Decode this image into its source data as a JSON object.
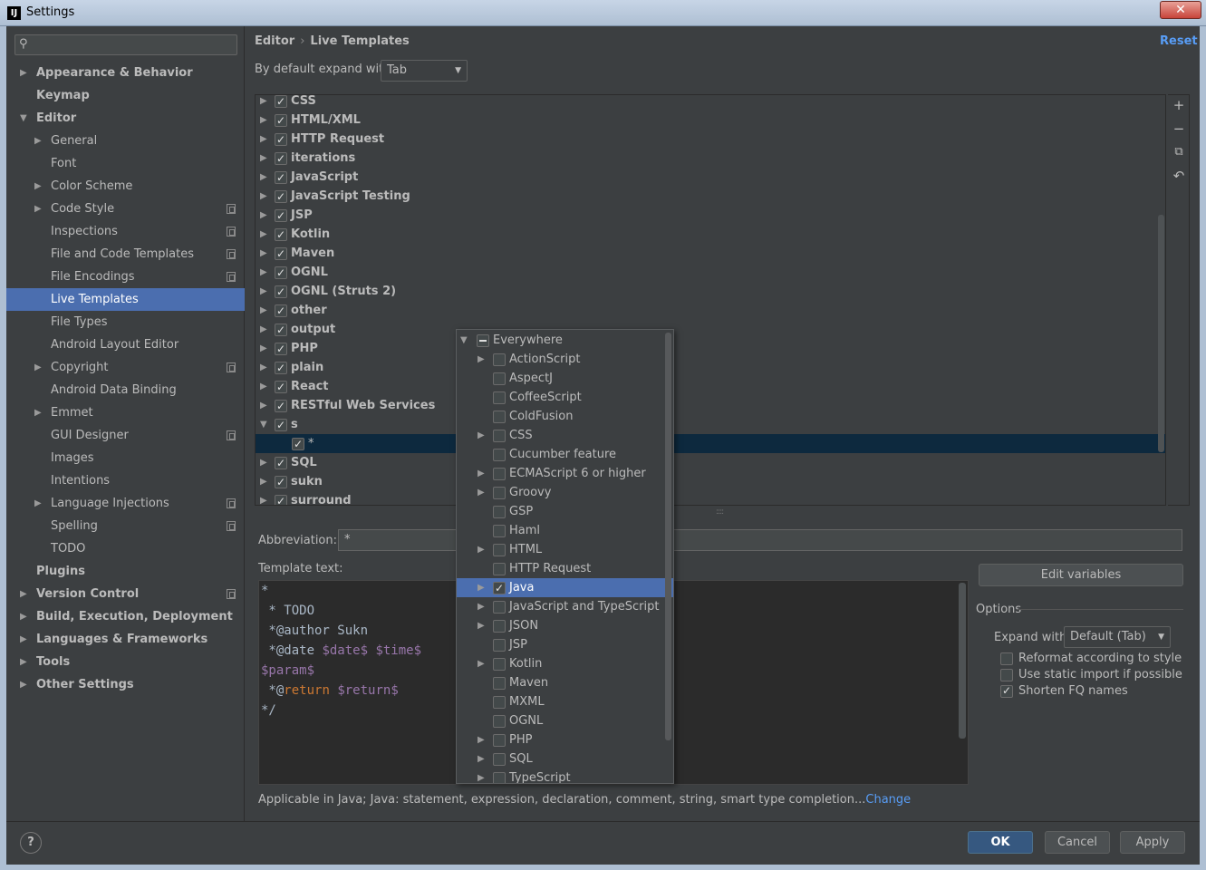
{
  "window": {
    "title": "Settings",
    "close_label": "✕",
    "app_icon": "IJ"
  },
  "search": {
    "placeholder": "",
    "icon": "search-icon"
  },
  "sidebar": {
    "items": [
      {
        "label": "Appearance & Behavior",
        "level": 0,
        "expand": "collapsed",
        "bold": true
      },
      {
        "label": "Keymap",
        "level": 0,
        "expand": "none",
        "bold": true
      },
      {
        "label": "Editor",
        "level": 0,
        "expand": "expanded",
        "bold": true
      },
      {
        "label": "General",
        "level": 1,
        "expand": "collapsed"
      },
      {
        "label": "Font",
        "level": 1,
        "expand": "none"
      },
      {
        "label": "Color Scheme",
        "level": 1,
        "expand": "collapsed"
      },
      {
        "label": "Code Style",
        "level": 1,
        "expand": "collapsed",
        "copy": true
      },
      {
        "label": "Inspections",
        "level": 1,
        "expand": "none",
        "copy": true
      },
      {
        "label": "File and Code Templates",
        "level": 1,
        "expand": "none",
        "copy": true
      },
      {
        "label": "File Encodings",
        "level": 1,
        "expand": "none",
        "copy": true
      },
      {
        "label": "Live Templates",
        "level": 1,
        "expand": "none",
        "selected": true
      },
      {
        "label": "File Types",
        "level": 1,
        "expand": "none"
      },
      {
        "label": "Android Layout Editor",
        "level": 1,
        "expand": "none"
      },
      {
        "label": "Copyright",
        "level": 1,
        "expand": "collapsed",
        "copy": true
      },
      {
        "label": "Android Data Binding",
        "level": 1,
        "expand": "none"
      },
      {
        "label": "Emmet",
        "level": 1,
        "expand": "collapsed"
      },
      {
        "label": "GUI Designer",
        "level": 1,
        "expand": "none",
        "copy": true
      },
      {
        "label": "Images",
        "level": 1,
        "expand": "none"
      },
      {
        "label": "Intentions",
        "level": 1,
        "expand": "none"
      },
      {
        "label": "Language Injections",
        "level": 1,
        "expand": "collapsed",
        "copy": true
      },
      {
        "label": "Spelling",
        "level": 1,
        "expand": "none",
        "copy": true
      },
      {
        "label": "TODO",
        "level": 1,
        "expand": "none"
      },
      {
        "label": "Plugins",
        "level": 0,
        "expand": "none",
        "bold": true
      },
      {
        "label": "Version Control",
        "level": 0,
        "expand": "collapsed",
        "bold": true,
        "copy": true
      },
      {
        "label": "Build, Execution, Deployment",
        "level": 0,
        "expand": "collapsed",
        "bold": true
      },
      {
        "label": "Languages & Frameworks",
        "level": 0,
        "expand": "collapsed",
        "bold": true
      },
      {
        "label": "Tools",
        "level": 0,
        "expand": "collapsed",
        "bold": true
      },
      {
        "label": "Other Settings",
        "level": 0,
        "expand": "collapsed",
        "bold": true
      }
    ]
  },
  "header": {
    "breadcrumb": [
      "Editor",
      "Live Templates"
    ],
    "breadcrumb_separator": "›",
    "reset": "Reset",
    "expand_label": "By default expand with",
    "expand_value": "Tab"
  },
  "template_groups": [
    {
      "name": "CSS",
      "checked": true,
      "expand": "collapsed"
    },
    {
      "name": "HTML/XML",
      "checked": true,
      "expand": "collapsed"
    },
    {
      "name": "HTTP Request",
      "checked": true,
      "expand": "collapsed"
    },
    {
      "name": "iterations",
      "checked": true,
      "expand": "collapsed"
    },
    {
      "name": "JavaScript",
      "checked": true,
      "expand": "collapsed"
    },
    {
      "name": "JavaScript Testing",
      "checked": true,
      "expand": "collapsed"
    },
    {
      "name": "JSP",
      "checked": true,
      "expand": "collapsed"
    },
    {
      "name": "Kotlin",
      "checked": true,
      "expand": "collapsed"
    },
    {
      "name": "Maven",
      "checked": true,
      "expand": "collapsed"
    },
    {
      "name": "OGNL",
      "checked": true,
      "expand": "collapsed"
    },
    {
      "name": "OGNL (Struts 2)",
      "checked": true,
      "expand": "collapsed"
    },
    {
      "name": "other",
      "checked": true,
      "expand": "collapsed"
    },
    {
      "name": "output",
      "checked": true,
      "expand": "collapsed"
    },
    {
      "name": "PHP",
      "checked": true,
      "expand": "collapsed"
    },
    {
      "name": "plain",
      "checked": true,
      "expand": "collapsed"
    },
    {
      "name": "React",
      "checked": true,
      "expand": "collapsed"
    },
    {
      "name": "RESTful Web Services",
      "checked": true,
      "expand": "collapsed"
    },
    {
      "name": "s",
      "checked": true,
      "expand": "expanded"
    },
    {
      "name": "*",
      "checked": true,
      "expand": "none",
      "child": true,
      "selected": true
    },
    {
      "name": "SQL",
      "checked": true,
      "expand": "collapsed"
    },
    {
      "name": "sukn",
      "checked": true,
      "expand": "collapsed"
    },
    {
      "name": "surround",
      "checked": true,
      "expand": "collapsed"
    },
    {
      "name": "",
      "checked": true,
      "expand": "collapsed"
    }
  ],
  "toolbar": {
    "add": "+",
    "remove": "−",
    "copy": "⧉",
    "restore": "↶"
  },
  "abbreviation": {
    "label": "Abbreviation:",
    "value": "*"
  },
  "template_text": {
    "label": "Template text:",
    "lines": [
      [
        {
          "t": "*"
        }
      ],
      [
        {
          "t": " * TODO"
        }
      ],
      [
        {
          "t": " *@author Sukn"
        }
      ],
      [
        {
          "t": " *@date "
        },
        {
          "t": "$date$",
          "c": "var"
        },
        {
          "t": " "
        },
        {
          "t": "$time$",
          "c": "var"
        }
      ],
      [
        {
          "t": "$param$",
          "c": "var"
        }
      ],
      [
        {
          "t": " *@"
        },
        {
          "t": "return",
          "c": "kw"
        },
        {
          "t": " "
        },
        {
          "t": "$return$",
          "c": "var"
        }
      ],
      [
        {
          "t": "*/"
        }
      ]
    ]
  },
  "edit_variables": "Edit variables",
  "options": {
    "title": "Options",
    "expand_with_label": "Expand with",
    "expand_with_value": "Default (Tab)",
    "reformat": {
      "label": "Reformat according to style",
      "checked": false
    },
    "static_import": {
      "label": "Use static import if possible",
      "checked": false
    },
    "shorten_fq": {
      "label": "Shorten FQ names",
      "checked": true
    }
  },
  "applicable": {
    "text": "Applicable in Java; Java: statement, expression, declaration, comment, string, smart type completion...",
    "link": "Change"
  },
  "context_popup": {
    "items": [
      {
        "name": "Everywhere",
        "root": true,
        "expand": "expanded",
        "state": "partial"
      },
      {
        "name": "ActionScript",
        "expand": "collapsed",
        "state": "off"
      },
      {
        "name": "AspectJ",
        "expand": "none",
        "state": "off"
      },
      {
        "name": "CoffeeScript",
        "expand": "none",
        "state": "off"
      },
      {
        "name": "ColdFusion",
        "expand": "none",
        "state": "off"
      },
      {
        "name": "CSS",
        "expand": "collapsed",
        "state": "off"
      },
      {
        "name": "Cucumber feature",
        "expand": "none",
        "state": "off"
      },
      {
        "name": "ECMAScript 6 or higher",
        "expand": "collapsed",
        "state": "off"
      },
      {
        "name": "Groovy",
        "expand": "collapsed",
        "state": "off"
      },
      {
        "name": "GSP",
        "expand": "none",
        "state": "off"
      },
      {
        "name": "Haml",
        "expand": "none",
        "state": "off"
      },
      {
        "name": "HTML",
        "expand": "collapsed",
        "state": "off"
      },
      {
        "name": "HTTP Request",
        "expand": "none",
        "state": "off"
      },
      {
        "name": "Java",
        "expand": "collapsed",
        "state": "on",
        "selected": true
      },
      {
        "name": "JavaScript and TypeScript",
        "expand": "collapsed",
        "state": "off"
      },
      {
        "name": "JSON",
        "expand": "collapsed",
        "state": "off"
      },
      {
        "name": "JSP",
        "expand": "none",
        "state": "off"
      },
      {
        "name": "Kotlin",
        "expand": "collapsed",
        "state": "off"
      },
      {
        "name": "Maven",
        "expand": "none",
        "state": "off"
      },
      {
        "name": "MXML",
        "expand": "none",
        "state": "off"
      },
      {
        "name": "OGNL",
        "expand": "none",
        "state": "off"
      },
      {
        "name": "PHP",
        "expand": "collapsed",
        "state": "off"
      },
      {
        "name": "SQL",
        "expand": "collapsed",
        "state": "off"
      },
      {
        "name": "TypeScript",
        "expand": "collapsed",
        "state": "off"
      }
    ]
  },
  "footer": {
    "help": "?",
    "ok": "OK",
    "cancel": "Cancel",
    "apply": "Apply"
  },
  "colors": {
    "accent": "#4b6eaf",
    "link": "#589df6",
    "background": "#3c3f41",
    "editor_bg": "#2b2b2b",
    "variable": "#9876aa",
    "keyword": "#cc7832"
  }
}
